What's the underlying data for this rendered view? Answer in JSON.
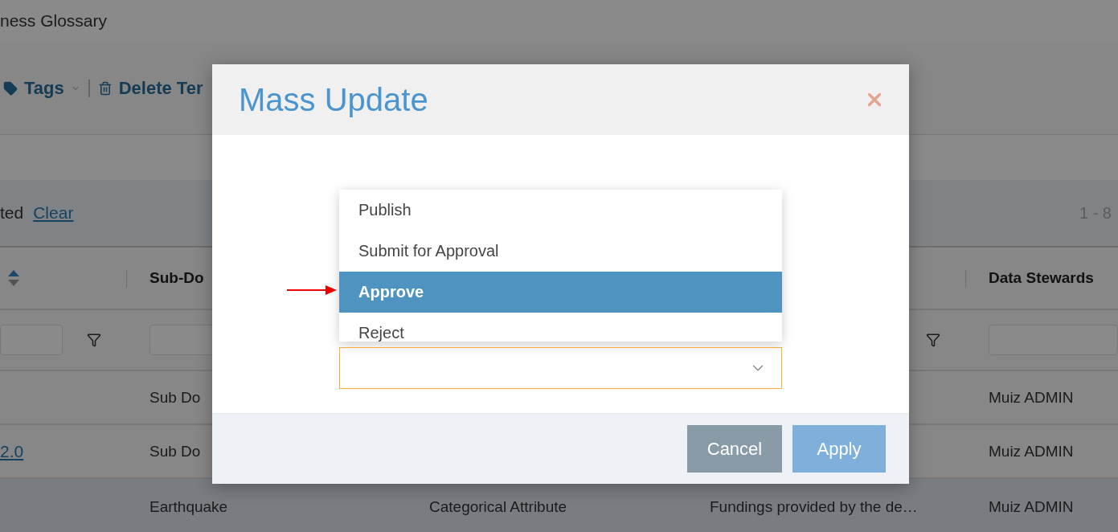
{
  "app": {
    "title": "ness Glossary"
  },
  "toolbar": [
    {
      "kind": "tags",
      "label": "Tags"
    },
    {
      "kind": "delete",
      "label": "Delete Ter"
    }
  ],
  "selection_bar": {
    "status": "ted",
    "clear_link": "Clear",
    "range": "1 - 8"
  },
  "table": {
    "columns": [
      {
        "kind": "sort"
      },
      {
        "kind": "label",
        "label": "Sub-Do"
      },
      {
        "kind": "covered"
      },
      {
        "kind": "covered"
      },
      {
        "kind": "label",
        "label": "Data Stewards"
      }
    ],
    "filters": [
      {
        "kind": "field_and_icon"
      },
      {
        "kind": "field"
      },
      {
        "kind": "empty"
      },
      {
        "kind": "icon"
      },
      {
        "kind": "field"
      }
    ],
    "rows": [
      {
        "highlighted": false,
        "column_2": "Sub Do",
        "column_5": "Muiz ADMIN"
      },
      {
        "highlighted": false,
        "column_1": "2.0",
        "column_2": "Sub Do",
        "column_5": "Muiz ADMIN"
      },
      {
        "highlighted": true,
        "column_2": "Earthquake",
        "column_3": "Categorical Attribute",
        "column_4": "Fundings provided by the de…",
        "column_5": "Muiz ADMIN"
      }
    ]
  },
  "modal": {
    "title": "Mass Update",
    "options": [
      {
        "label": "Publish",
        "selected": false
      },
      {
        "label": "Submit for Approval",
        "selected": false
      },
      {
        "label": "Approve",
        "selected": true
      },
      {
        "label": "Reject",
        "selected": false
      }
    ],
    "select": {
      "focused": true
    },
    "buttons": [
      {
        "kind": "secondary",
        "label": "Cancel"
      },
      {
        "kind": "primary",
        "label": "Apply"
      }
    ]
  }
}
